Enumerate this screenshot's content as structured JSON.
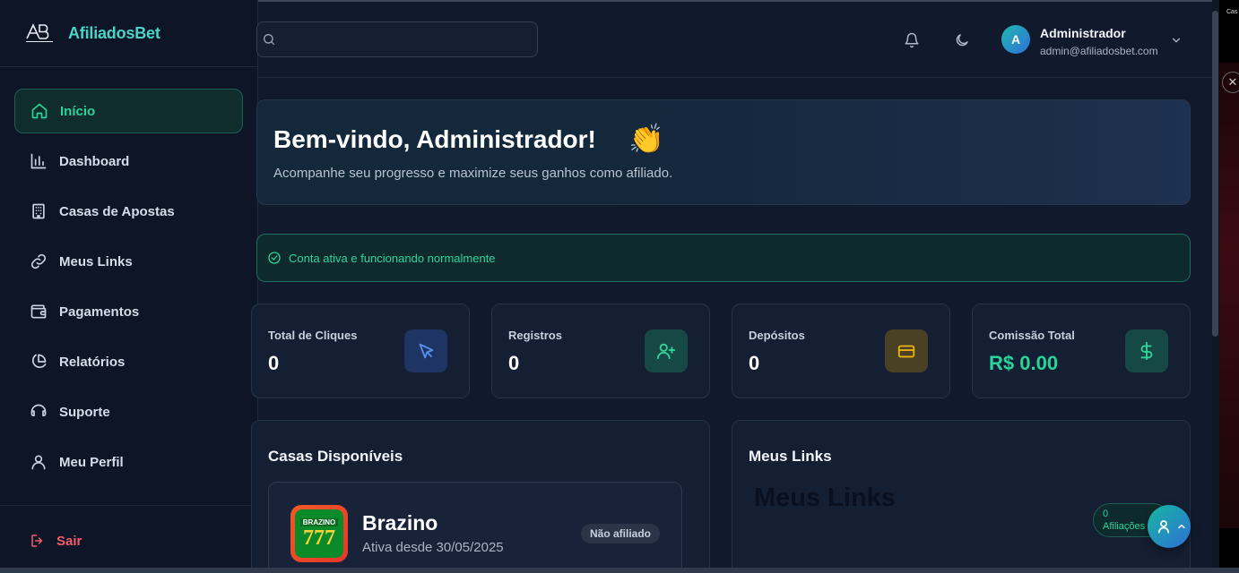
{
  "brand": {
    "logo_text": "AB AFILIADOSBET",
    "name": "AfiliadosBet"
  },
  "sidebar": {
    "items": [
      {
        "label": "Início",
        "icon": "home-icon",
        "active": true
      },
      {
        "label": "Dashboard",
        "icon": "bar-chart-icon",
        "active": false
      },
      {
        "label": "Casas de Apostas",
        "icon": "building-icon",
        "active": false
      },
      {
        "label": "Meus Links",
        "icon": "link-icon",
        "active": false
      },
      {
        "label": "Pagamentos",
        "icon": "wallet-icon",
        "active": false
      },
      {
        "label": "Relatórios",
        "icon": "pie-chart-icon",
        "active": false
      },
      {
        "label": "Suporte",
        "icon": "headphones-icon",
        "active": false
      },
      {
        "label": "Meu Perfil",
        "icon": "user-icon",
        "active": false
      }
    ],
    "logout_label": "Sair"
  },
  "header": {
    "search_placeholder": "",
    "user": {
      "initial": "A",
      "name": "Administrador",
      "email": "admin@afiliadosbet.com"
    }
  },
  "welcome": {
    "title": "Bem-vindo, Administrador!",
    "emoji": "👏",
    "subtitle": "Acompanhe seu progresso e maximize seus ganhos como afiliado."
  },
  "alert": {
    "text": "Conta ativa e funcionando normalmente"
  },
  "stats": [
    {
      "label": "Total de Cliques",
      "value": "0",
      "icon": "cursor-click-icon",
      "color": "#3b82f6"
    },
    {
      "label": "Registros",
      "value": "0",
      "icon": "user-plus-icon",
      "color": "#22c58e"
    },
    {
      "label": "Depósitos",
      "value": "0",
      "icon": "credit-card-icon",
      "color": "#eab308"
    },
    {
      "label": "Comissão Total",
      "value": "R$ 0.00",
      "icon": "dollar-icon",
      "color": "#22c58e"
    }
  ],
  "casas": {
    "title": "Casas Disponíveis",
    "items": [
      {
        "logo_top": "BRAZINO",
        "logo_num": "777",
        "name": "Brazino",
        "since": "Ativa desde 30/05/2025",
        "status": "Não afiliado"
      }
    ]
  },
  "links": {
    "title": "Meus Links",
    "heading": "Meus Links",
    "affiliations_count": "0",
    "affiliations_label": "Afiliações"
  },
  "edge": {
    "tab_text": "Cas"
  },
  "colors": {
    "accent": "#28d49a",
    "brand": "#4ad3c7",
    "danger": "#f25c67",
    "background": "#111a2c"
  }
}
